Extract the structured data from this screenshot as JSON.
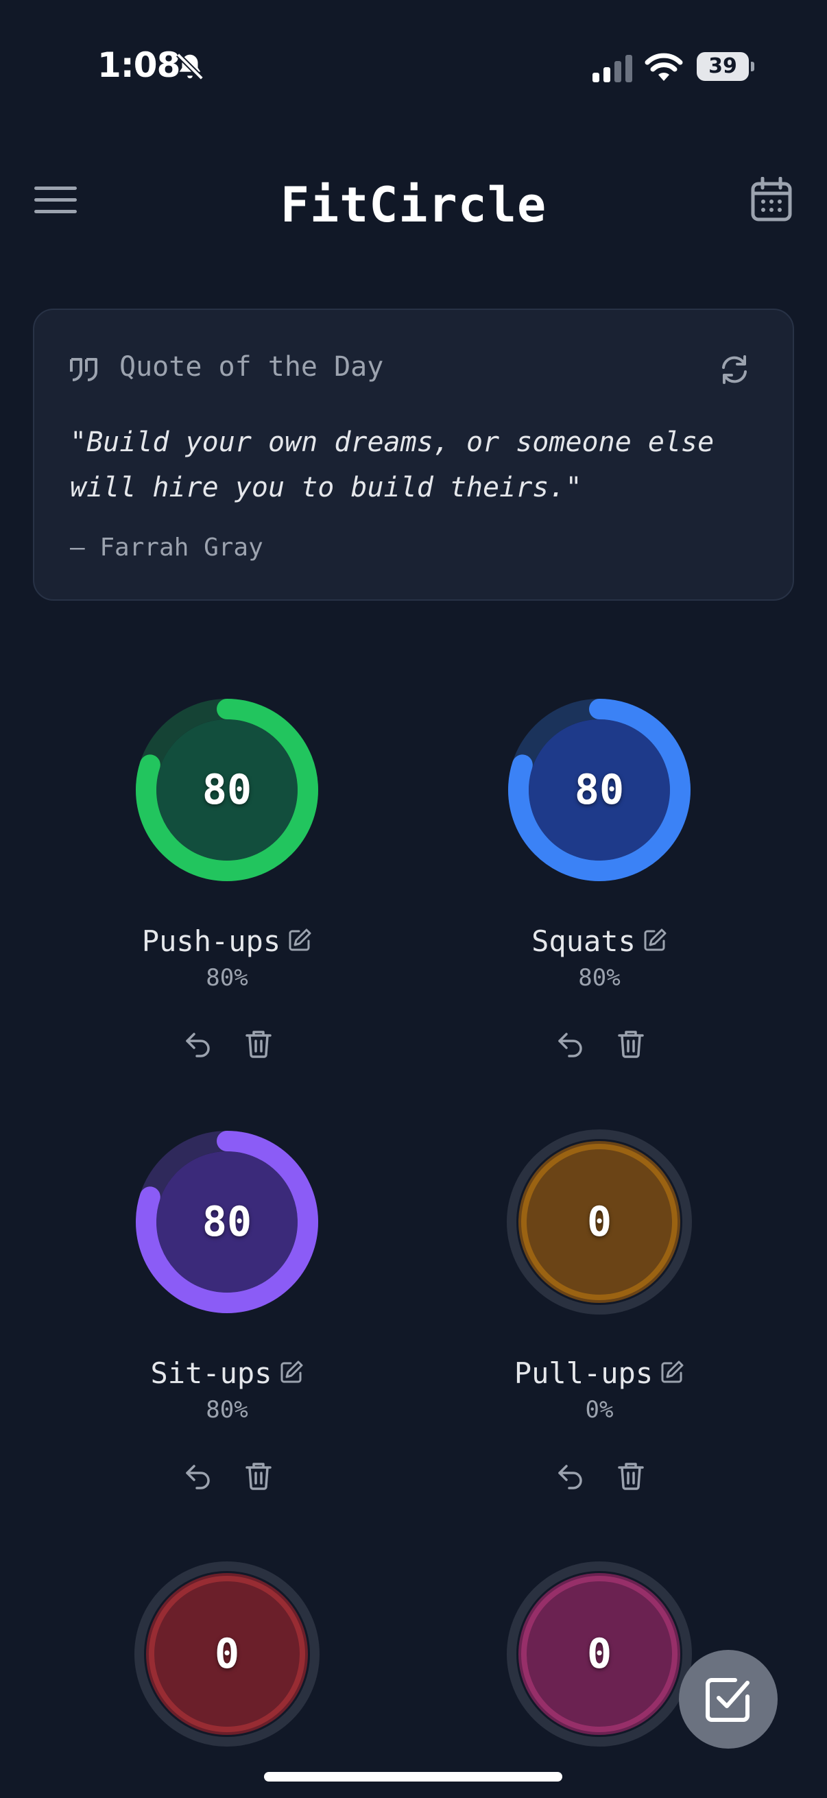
{
  "status_bar": {
    "time": "1:08",
    "battery": "39"
  },
  "header": {
    "title": "FitCircle"
  },
  "quote": {
    "heading": "Quote of the Day",
    "text": "\"Build your own dreams, or someone else will hire you to build theirs.\"",
    "author": "— Farrah Gray"
  },
  "exercises": [
    {
      "name": "Push-ups",
      "count": "80",
      "percent_label": "80%",
      "progress": 0.8,
      "ring_color": "#22c55e",
      "fill_color": "#124e3d"
    },
    {
      "name": "Squats",
      "count": "80",
      "percent_label": "80%",
      "progress": 0.8,
      "ring_color": "#3b82f6",
      "fill_color": "#1e3a8a"
    },
    {
      "name": "Sit-ups",
      "count": "80",
      "percent_label": "80%",
      "progress": 0.8,
      "ring_color": "#8b5cf6",
      "fill_color": "#3b2a7a"
    },
    {
      "name": "Pull-ups",
      "count": "0",
      "percent_label": "0%",
      "progress": 0,
      "ring_color": "#f59e0b",
      "fill_color": "#6b4416"
    },
    {
      "count": "0",
      "progress": 0,
      "ring_color": "#ef4444",
      "fill_color": "#6b1f2a"
    },
    {
      "count": "0",
      "progress": 0,
      "ring_color": "#ec4899",
      "fill_color": "#6b2251"
    }
  ]
}
